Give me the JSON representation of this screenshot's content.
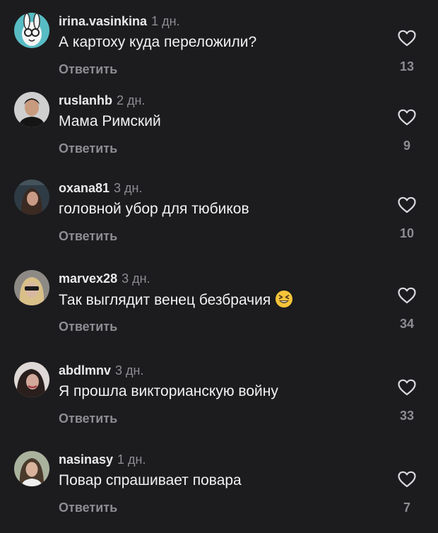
{
  "reply_label": "Ответить",
  "comments": [
    {
      "username": "irina.vasinkina",
      "time": "1 дн.",
      "text": "А картоху куда переложили?",
      "likes": "13"
    },
    {
      "username": "ruslanhb",
      "time": "2 дн.",
      "text": "Мама Римский",
      "likes": "9"
    },
    {
      "username": "oxana81",
      "time": "3 дн.",
      "text": "головной убор для тюбиков",
      "likes": "10"
    },
    {
      "username": "marvex28",
      "time": "3 дн.",
      "text": "Так выглядит венец безбрачия",
      "emoji": "😆",
      "likes": "34"
    },
    {
      "username": "abdlmnv",
      "time": "3 дн.",
      "text": "Я прошла викторианскую войну",
      "likes": "33"
    },
    {
      "username": "nasinasy",
      "time": "1 дн.",
      "text": "Повар спрашивает повара",
      "likes": "7"
    }
  ],
  "colors": {
    "background": "#1c1c1e",
    "username": "#e9e9ec",
    "secondary": "#8d8d93",
    "text": "#f2f2f4"
  },
  "icons": [
    "heart-outline-icon",
    "user-avatar",
    "grinning-squinting-face-emoji"
  ]
}
